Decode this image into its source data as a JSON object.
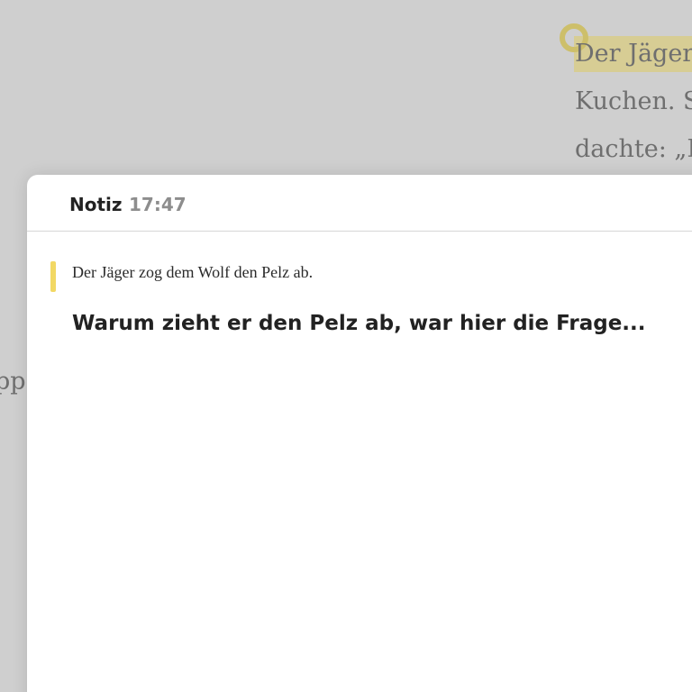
{
  "reader": {
    "lines": [
      "Der Jäger",
      "Kuchen. S",
      "dachte: „I"
    ],
    "left_fragment": "pp"
  },
  "note": {
    "title": "Notiz",
    "time": "17:47",
    "quote": "Der Jäger zog dem Wolf den Pelz ab.",
    "body": "Warum zieht er den Pelz ab, war hier die Frage..."
  },
  "colors": {
    "highlight": "#d8cd8a",
    "quote_bar": "#f2d864",
    "background": "#cfcfcf"
  }
}
